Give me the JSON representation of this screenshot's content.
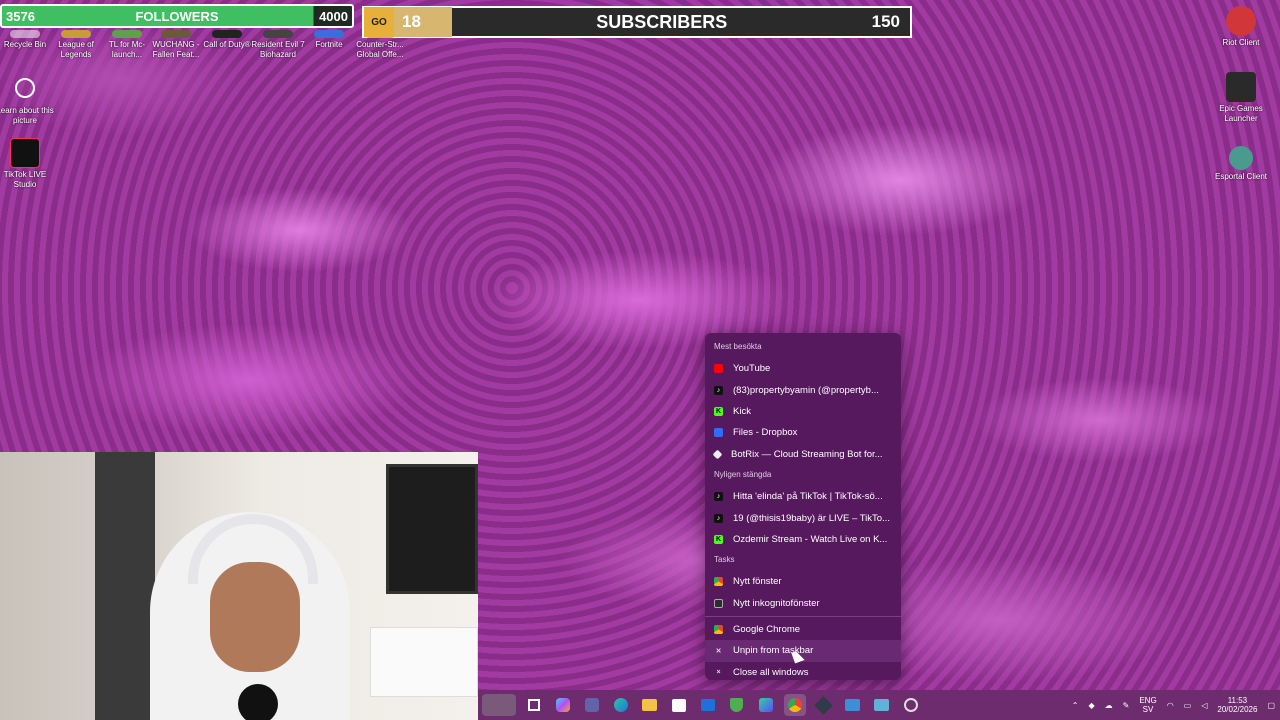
{
  "overlay": {
    "followers": {
      "current": "3576",
      "label": "FOLLOWERS",
      "goal": "4000",
      "progress_fraction": 0.894
    },
    "subscribers": {
      "count": "18",
      "label": "SUBSCRIBERS",
      "goal": "150"
    }
  },
  "desktop_icons_left": [
    {
      "label": "Recycle Bin",
      "icon": "recycle-bin-icon"
    },
    {
      "label": "League of Legends",
      "icon": "league-icon"
    },
    {
      "label": "TL for Mc-launch...",
      "icon": "tlauncher-icon"
    },
    {
      "label": "WUCHANG - Fallen Feat...",
      "icon": "wuchang-icon"
    },
    {
      "label": "Call of Duty®",
      "icon": "cod-icon"
    },
    {
      "label": "Resident Evil 7 Biohazard",
      "icon": "re7-icon"
    },
    {
      "label": "Fortnite",
      "icon": "fortnite-icon"
    },
    {
      "label": "Counter-Str... Global Offe...",
      "icon": "csgo-icon"
    }
  ],
  "desktop_icons_col": [
    {
      "label": "Learn about this picture",
      "icon": "learn-picture-icon"
    },
    {
      "label": "TikTok LIVE Studio",
      "icon": "tiktok-icon"
    }
  ],
  "desktop_icons_right": [
    {
      "label": "Riot Client",
      "icon": "riot-icon"
    },
    {
      "label": "Epic Games Launcher",
      "icon": "epic-icon"
    },
    {
      "label": "Esportal Client",
      "icon": "esportal-icon"
    }
  ],
  "jumplist": {
    "most_visited_header": "Mest besökta",
    "most_visited": [
      {
        "label": "YouTube",
        "icon": "yt"
      },
      {
        "label": "(83)propertybyamin (@propertyb...",
        "icon": "tt"
      },
      {
        "label": "Kick",
        "icon": "kick"
      },
      {
        "label": "Files - Dropbox",
        "icon": "dbx"
      },
      {
        "label": "BotRix — Cloud Streaming Bot for...",
        "icon": "bot"
      }
    ],
    "recent_header": "Nyligen stängda",
    "recent": [
      {
        "label": "Hitta 'elinda' på TikTok | TikTok-sö...",
        "icon": "tt"
      },
      {
        "label": "19 (@thisis19baby) är LIVE – TikTo...",
        "icon": "tt"
      },
      {
        "label": "Ozdemir Stream - Watch Live on K...",
        "icon": "kick"
      }
    ],
    "tasks_header": "Tasks",
    "tasks": [
      {
        "label": "Nytt fönster",
        "icon": "chrome"
      },
      {
        "label": "Nytt inkognitofönster",
        "icon": "incog"
      }
    ],
    "app_actions": [
      {
        "label": "Google Chrome",
        "icon": "chrome"
      },
      {
        "label": "Unpin from taskbar",
        "icon": "unpin"
      },
      {
        "label": "Close all windows",
        "icon": "close"
      }
    ]
  },
  "taskbar": {
    "apps": [
      "widgets-icon",
      "start-icon",
      "copilot-icon",
      "teams-icon",
      "edge-icon",
      "file-explorer-icon",
      "store-icon",
      "mail-icon",
      "shield-icon",
      "m365-icon",
      "chrome-icon",
      "app-icon",
      "photos-icon",
      "control-panel-icon",
      "steam-icon"
    ],
    "language": {
      "line1": "ENG",
      "line2": "SV"
    },
    "time": "11:53",
    "date": "20/02/2026"
  }
}
